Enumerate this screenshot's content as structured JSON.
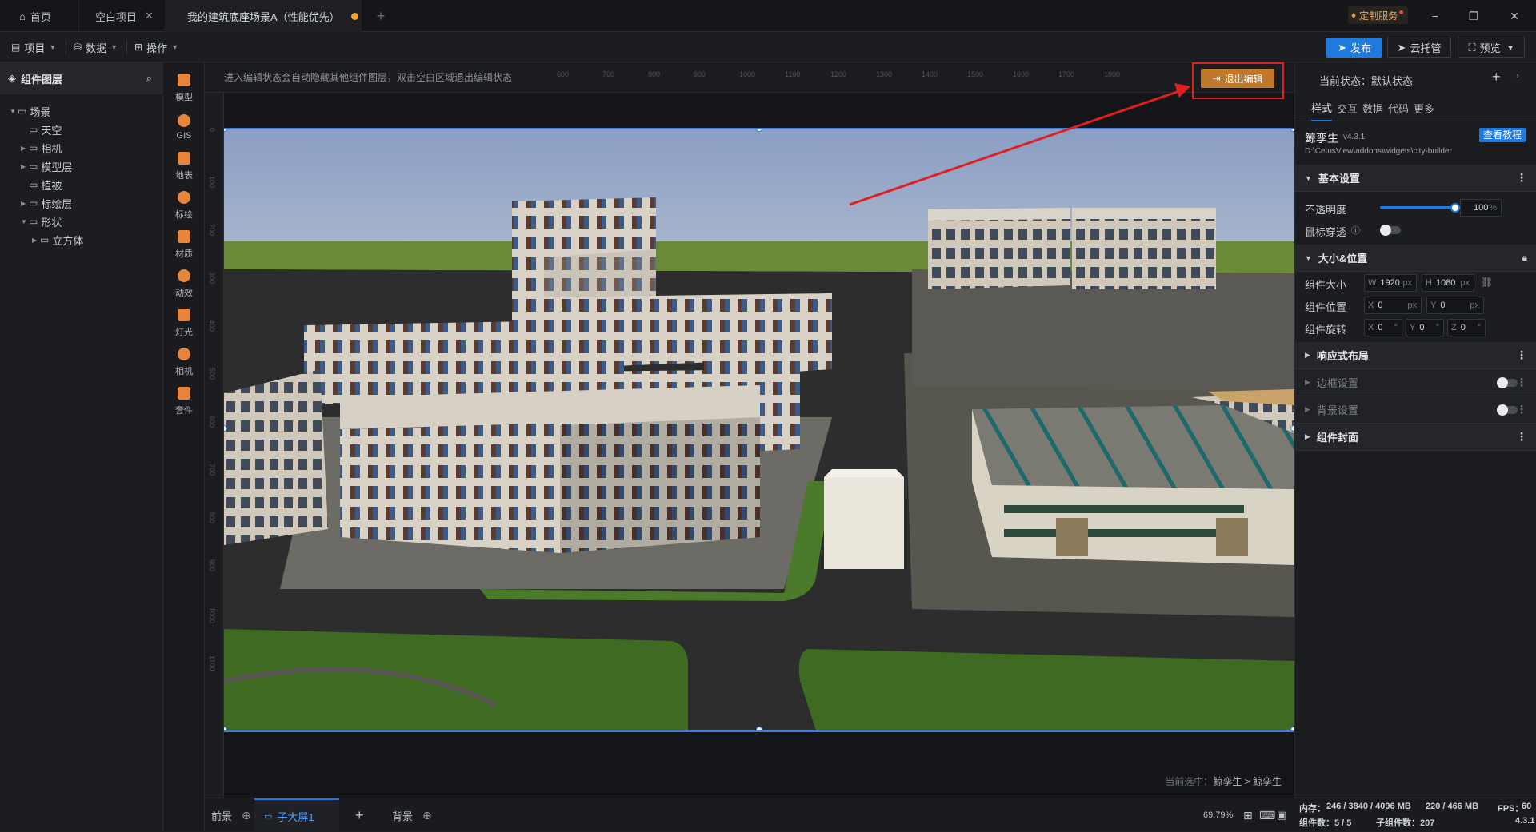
{
  "tabs": {
    "home": "首页",
    "blank_project": "空白项目",
    "scene": "我的建筑底座场景A（性能优先）",
    "add": "+"
  },
  "window": {
    "custom_service": "定制服务",
    "minimize": "−",
    "restore": "❐",
    "close": "✕"
  },
  "toolbar": {
    "project": "项目",
    "data": "数据",
    "operation": "操作",
    "publish": "发布",
    "cloud_host": "云托管",
    "preview": "预览"
  },
  "layers": {
    "title": "组件图层",
    "items": [
      {
        "label": "场景",
        "depth": 0,
        "expanded": true
      },
      {
        "label": "天空",
        "depth": 1,
        "expanded": null
      },
      {
        "label": "相机",
        "depth": 1,
        "expanded": false
      },
      {
        "label": "模型层",
        "depth": 1,
        "expanded": false
      },
      {
        "label": "植被",
        "depth": 1,
        "expanded": null
      },
      {
        "label": "标绘层",
        "depth": 1,
        "expanded": false
      },
      {
        "label": "形状",
        "depth": 1,
        "expanded": true
      },
      {
        "label": "立方体",
        "depth": 2,
        "expanded": false
      }
    ]
  },
  "tools": [
    "模型",
    "GIS",
    "地表",
    "标绘",
    "材质",
    "动效",
    "灯光",
    "相机",
    "套件"
  ],
  "canvas": {
    "hint": "进入编辑状态会自动隐藏其他组件图层，双击空白区域退出编辑状态",
    "exit_edit": "退出编辑",
    "selected_prefix": "当前选中：",
    "selected_path": "鲸孪生 > 鲸孪生",
    "hruler": [
      "600",
      "700",
      "800",
      "900",
      "1000",
      "1100",
      "1200",
      "1300",
      "1400",
      "1500",
      "1600",
      "1700",
      "1800"
    ],
    "vruler": [
      "0",
      "100",
      "200",
      "300",
      "400",
      "500",
      "600",
      "700",
      "800",
      "900",
      "1000",
      "1100"
    ]
  },
  "bottom": {
    "foreground": "前景",
    "sub_screen": "子大屏1",
    "background": "背景",
    "zoom": "69.79%"
  },
  "props": {
    "state_label": "当前状态：默认状态",
    "tabs": [
      "样式",
      "交互",
      "数据",
      "代码",
      "更多"
    ],
    "widget_name": "鲸孪生",
    "widget_version": "v4.3.1",
    "widget_path": "D:\\CetusView\\addons\\widgets\\city-builder",
    "tutorial": "查看教程",
    "basic": "基本设置",
    "opacity_label": "不透明度",
    "opacity_value": "100",
    "opacity_unit": "%",
    "opacity_fraction": 1.0,
    "mouse_through": "鼠标穿透",
    "size_pos": "大小&位置",
    "size_label": "组件大小",
    "w_prefix": "W",
    "w_value": "1920",
    "h_prefix": "H",
    "h_value": "1080",
    "px": "px",
    "pos_label": "组件位置",
    "x_prefix": "X",
    "x_value": "0",
    "y_prefix": "Y",
    "y_value": "0",
    "rot_label": "组件旋转",
    "z_prefix": "Z",
    "rot_x": "0",
    "rot_y": "0",
    "rot_z": "0",
    "deg": "°",
    "responsive": "响应式布局",
    "border": "边框设置",
    "bg": "背景设置",
    "cover": "组件封面"
  },
  "status": {
    "mem_label": "内存：",
    "mem_value": "246 / 3840 / 4096 MB",
    "mem_value2": "220 / 466 MB",
    "fps_label": "FPS：",
    "fps_value": "60",
    "count_label": "组件数：5 / 5",
    "sub_label": "子组件数：207",
    "version": "4.3.1"
  },
  "colors": {
    "accent": "#1f7ae0",
    "exit_btn": "#c0782a",
    "annotation": "#e02020",
    "unsaved_dot": "#f0a52c"
  }
}
